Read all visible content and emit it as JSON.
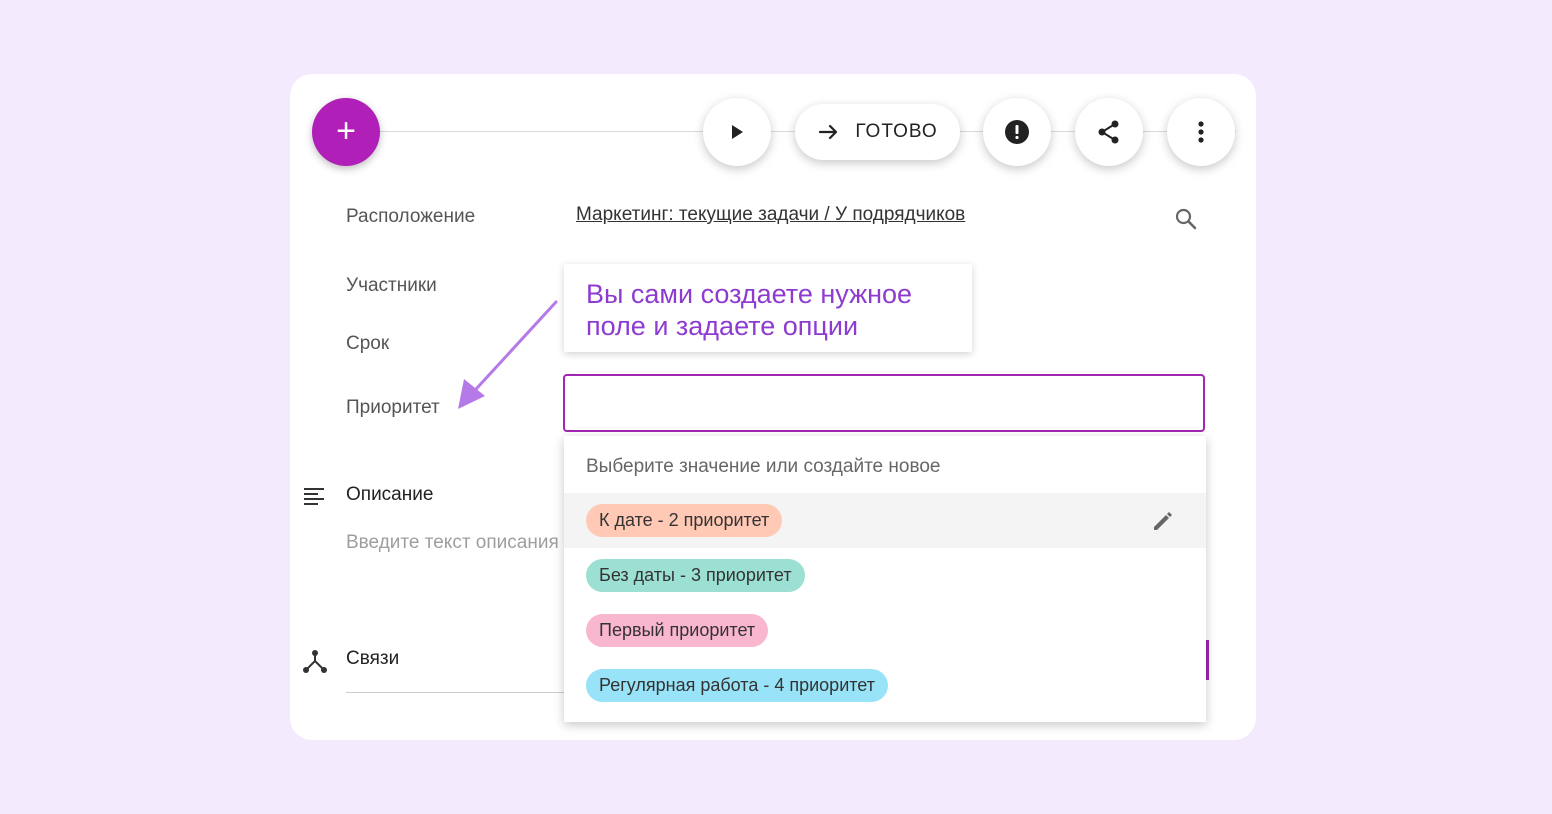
{
  "toolbar": {
    "add_label": "+",
    "done_label": "ГОТОВО",
    "icons": [
      "plus-icon",
      "play-icon",
      "arrow-right-icon",
      "alert-icon",
      "share-icon",
      "more-vert-icon"
    ]
  },
  "fields": {
    "location_label": "Расположение",
    "location_value": "Маркетинг: текущие задачи / У подрядчиков",
    "participants_label": "Участники",
    "deadline_label": "Срок",
    "priority_label": "Приоритет"
  },
  "description": {
    "title": "Описание",
    "placeholder": "Введите текст описания"
  },
  "links": {
    "title": "Связи"
  },
  "tooltip": {
    "line1": "Вы сами создаете нужное",
    "line2": "поле и задаете опции"
  },
  "dropdown": {
    "hint": "Выберите значение или создайте новое",
    "options": [
      {
        "label": "К дате - 2 приоритет",
        "color": "#ffc9b5"
      },
      {
        "label": "Без даты - 3 приоритет",
        "color": "#9be0d3"
      },
      {
        "label": "Первый приоритет",
        "color": "#f9b6cf"
      },
      {
        "label": "Регулярная работа - 4 приоритет",
        "color": "#98e3f7"
      }
    ]
  },
  "colors": {
    "accent": "#b020b8",
    "tooltip_text": "#8e3bd0",
    "background": "#f3eafd"
  }
}
